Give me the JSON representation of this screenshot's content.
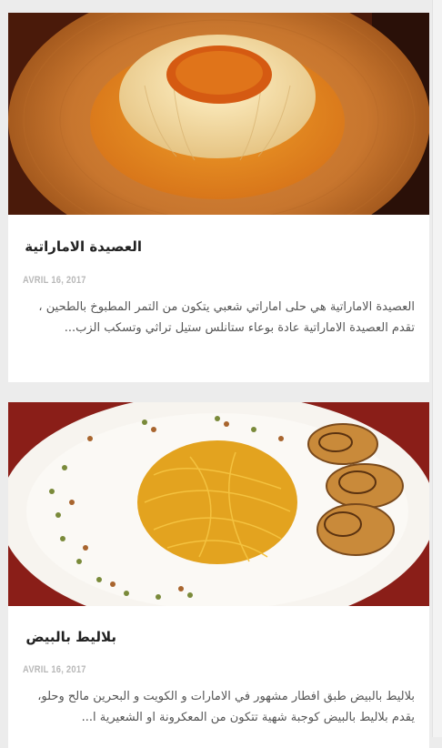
{
  "posts": [
    {
      "title": "العصيدة الاماراتية",
      "date": "AVRIL 16, 2017",
      "excerpt": "العصيدة الاماراتية هي حلى اماراتي شعبي يتكون من التمر المطبوخ بالطحين ، تقدم العصيدة الاماراتية عادة بوعاء ستانلس ستيل تراثي وتسكب الزب...",
      "image": "asida-dessert-photo"
    },
    {
      "title": "بلاليط بالبيض",
      "date": "AVRIL 16, 2017",
      "excerpt": "بلاليط بالبيض طبق افطار مشهور في الامارات و الكويت و البحرين مالح وحلو، يقدم بلاليط بالبيض كوجبة شهية تتكون من المعكرونة او الشعيرية ا...",
      "image": "balaleet-egg-photo"
    }
  ]
}
